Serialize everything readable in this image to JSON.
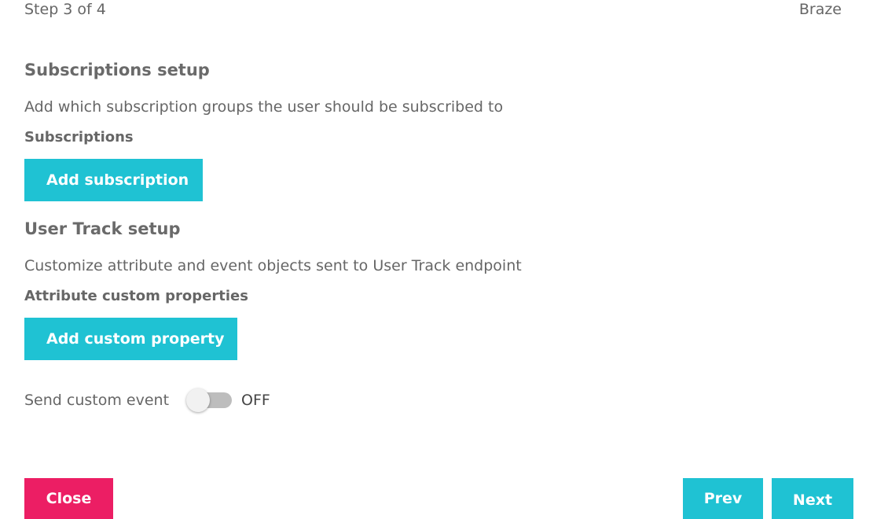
{
  "header": {
    "step_text": "Step 3 of 4",
    "integration_name": "Braze"
  },
  "subscriptions": {
    "title": "Subscriptions setup",
    "description": "Add which subscription groups the user should be subscribed to",
    "field_label": "Subscriptions",
    "add_button_label": "Add subscription"
  },
  "user_track": {
    "title": "User Track setup",
    "description": "Customize attribute and event objects sent to User Track endpoint",
    "field_label": "Attribute custom properties",
    "add_button_label": "Add custom property",
    "custom_event_toggle": {
      "label": "Send custom event",
      "state_text": "OFF",
      "enabled": false
    }
  },
  "footer": {
    "close_label": "Close",
    "prev_label": "Prev",
    "next_label": "Next"
  },
  "colors": {
    "primary_teal": "#1fc2d3",
    "close_pink": "#ec1e64",
    "toggle_off_track": "#bdbdbd",
    "text_gray": "#666666"
  }
}
